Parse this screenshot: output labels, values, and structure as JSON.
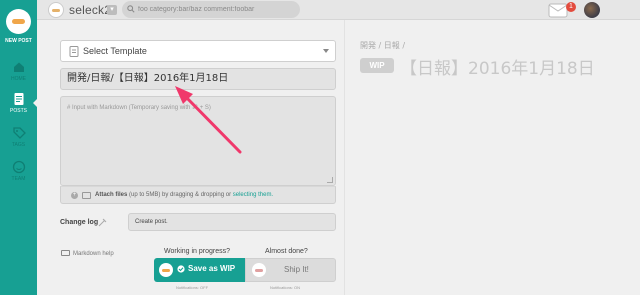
{
  "app": {
    "team_name": "seleck2",
    "team_dropdown": "▾",
    "search": {
      "placeholder": "foo category:bar/baz comment:foobar"
    },
    "notification_count": "1"
  },
  "sidebar": {
    "new_post_label": "NEW POST",
    "items": [
      {
        "label": "HOME",
        "icon": "home-icon"
      },
      {
        "label": "POSTS",
        "icon": "posts-icon",
        "active": true
      },
      {
        "label": "TAGS",
        "icon": "tags-icon"
      },
      {
        "label": "TEAM",
        "icon": "team-icon"
      }
    ]
  },
  "editor": {
    "template_label": "Select Template",
    "title_value": "開発/日報/【日報】2016年1月18日",
    "body_placeholder": "# Input with Markdown (Temporary saving with ⌘ + S)",
    "attach": {
      "label": "Attach files",
      "hint": " (up to 5MB) by dragging & dropping or ",
      "link": "selecting them."
    },
    "change_log_label": "Change log",
    "change_log_value": "Create post.",
    "markdown_help": "Markdown help",
    "wip_heading": "Working in progress?",
    "done_heading": "Almost done?",
    "save_wip_label": "Save as WIP",
    "ship_label": "Ship It!",
    "wip_notify": "Notifications: OFF",
    "ship_notify": "Notifications: ON"
  },
  "preview": {
    "category": "開発 / 日報 /",
    "wip_badge": "WIP",
    "title": "【日報】2016年1月18日"
  },
  "colors": {
    "brand_teal": "#17a093",
    "annotation_pink": "#f0386b",
    "notify_red": "#e34b3d"
  }
}
